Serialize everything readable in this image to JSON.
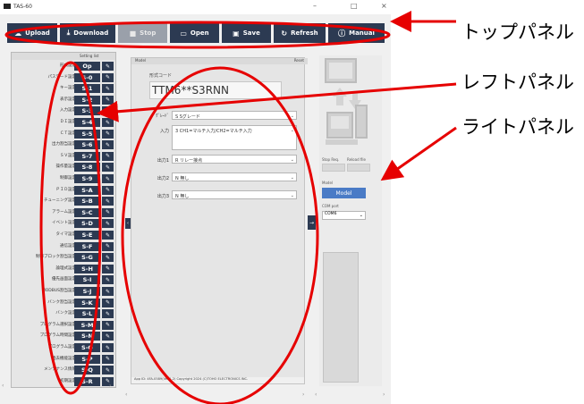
{
  "app": {
    "title": "TAS-60",
    "window_buttons": [
      "–",
      "□",
      "×"
    ]
  },
  "toolbar": {
    "buttons": [
      {
        "label": "Upload",
        "icon": "cloud-upload-icon",
        "enabled": true
      },
      {
        "label": "Download",
        "icon": "download-icon",
        "enabled": true
      },
      {
        "label": "Stop",
        "icon": "stop-icon",
        "enabled": false
      },
      {
        "label": "Open",
        "icon": "folder-icon",
        "enabled": true
      },
      {
        "label": "Save",
        "icon": "save-icon",
        "enabled": true
      },
      {
        "label": "Refresh",
        "icon": "refresh-icon",
        "enabled": true
      },
      {
        "label": "Manual",
        "icon": "info-icon",
        "enabled": true
      }
    ]
  },
  "left_panel": {
    "header": "Setting list",
    "rows": [
      {
        "label": "形式設定",
        "code": "Op"
      },
      {
        "label": "パスワード設定",
        "code": "S-0"
      },
      {
        "label": "キー設定",
        "code": "S-1"
      },
      {
        "label": "表示設定",
        "code": "S-2"
      },
      {
        "label": "入力設定",
        "code": "S-3"
      },
      {
        "label": "ＤＩ設定",
        "code": "S-4"
      },
      {
        "label": "ＣＴ設定",
        "code": "S-5"
      },
      {
        "label": "出力割当設定",
        "code": "S-6"
      },
      {
        "label": "ＳＶ設定",
        "code": "S-7"
      },
      {
        "label": "操作量設定",
        "code": "S-8"
      },
      {
        "label": "制御設定",
        "code": "S-9"
      },
      {
        "label": "ＰＩＤ設定",
        "code": "S-A"
      },
      {
        "label": "チューニング設定",
        "code": "S-B"
      },
      {
        "label": "アラーム設定",
        "code": "S-C"
      },
      {
        "label": "イベント設定",
        "code": "S-D"
      },
      {
        "label": "タイマ設定",
        "code": "S-E"
      },
      {
        "label": "通信設定",
        "code": "S-F"
      },
      {
        "label": "制御ブロック割当設定",
        "code": "S-G"
      },
      {
        "label": "論理式設定",
        "code": "S-H"
      },
      {
        "label": "優先画面設定",
        "code": "S-I"
      },
      {
        "label": "MODBUS割当設定",
        "code": "S-J"
      },
      {
        "label": "バンク割当設定",
        "code": "S-K"
      },
      {
        "label": "バンク設定",
        "code": "S-L"
      },
      {
        "label": "プログラム選択設定",
        "code": "S-M"
      },
      {
        "label": "プログラム時間設定",
        "code": "S-N"
      },
      {
        "label": "プログラム設定",
        "code": "S-O"
      },
      {
        "label": "過去機能設定",
        "code": "S-P"
      },
      {
        "label": "メンテナンス情報",
        "code": "S-Q"
      },
      {
        "label": "初期設定",
        "code": "S-R"
      }
    ]
  },
  "center_panel": {
    "header": "Model",
    "header_right": "Reset",
    "model_label": "形式コード",
    "model_code": "TTM6**S3RNN",
    "fields": [
      {
        "label": "ｸﾞﾚｰﾄﾞ",
        "value": "S  Sグレード"
      },
      {
        "label": "入力",
        "value": "3  CH1=マルチ入力/CH2=マルチ入力"
      },
      {
        "label": "出力1",
        "value": "R  リレー接点"
      },
      {
        "label": "出力2",
        "value": "N  無し"
      },
      {
        "label": "出力3",
        "value": "N  無し"
      }
    ],
    "status": "App ID: 4FA-0589(Ver.1.2)  Copyright 2024 (C)TOHO ELECTRONICS INC."
  },
  "right_panel": {
    "stop_req_label": "Stop Req.",
    "reload_label": "Reload file",
    "model_section_label": "Model",
    "model_button": "Model",
    "com_port_label": "COM port",
    "com_port_value": "COM6"
  },
  "annotations": {
    "top_panel": "トップパネル",
    "left_panel": "レフトパネル",
    "right_panel": "ライトパネル"
  },
  "colors": {
    "button_dark": "#2c3a52",
    "button_disabled": "#9aa0aa",
    "accent_blue": "#4a7bc6",
    "annotation_red": "#e60000"
  }
}
